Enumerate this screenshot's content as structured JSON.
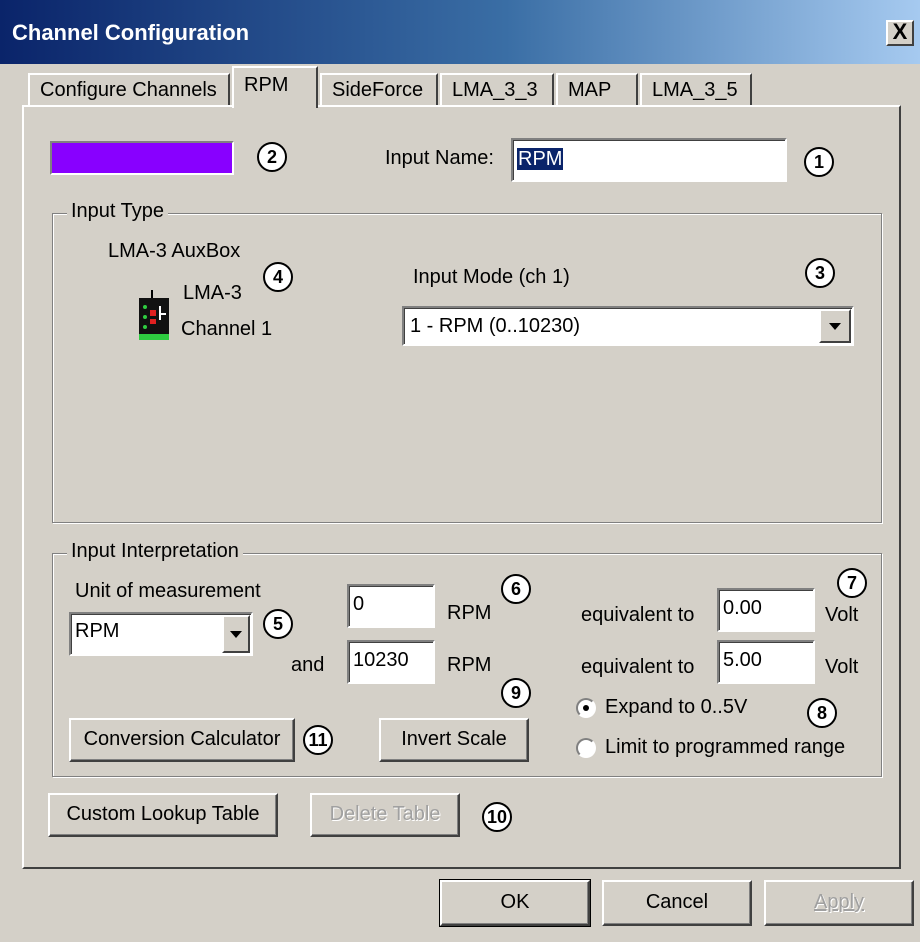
{
  "window": {
    "title": "Channel Configuration",
    "close_label": "X"
  },
  "tabs": [
    {
      "label": "Configure Channels",
      "active": false
    },
    {
      "label": "RPM",
      "active": true
    },
    {
      "label": "SideForce",
      "active": false
    },
    {
      "label": "LMA_3_3",
      "active": false
    },
    {
      "label": "MAP",
      "active": false
    },
    {
      "label": "LMA_3_5",
      "active": false
    }
  ],
  "colors": {
    "channel_color": "#8800ff",
    "title_gradient_start": "#0a246a",
    "dialog_bg": "#d4d0c8"
  },
  "input_name": {
    "label": "Input Name:",
    "value": "RPM"
  },
  "input_type": {
    "legend": "Input Type",
    "device_title": "LMA-3 AuxBox",
    "device_name": "LMA-3",
    "device_channel": "Channel 1",
    "device_icon": "lma3-device-icon",
    "mode_label": "Input Mode (ch 1)",
    "mode_selected": "1 - RPM (0..10230)"
  },
  "interpretation": {
    "legend": "Input Interpretation",
    "unit_label": "Unit of measurement",
    "unit_selected": "RPM",
    "and_label": "and",
    "min_value": "0",
    "max_value": "10230",
    "min_unit": "RPM",
    "max_unit": "RPM",
    "equiv_label_1": "equivalent to",
    "equiv_label_2": "equivalent to",
    "volt_min": "0.00",
    "volt_max": "5.00",
    "volt_unit_1": "Volt",
    "volt_unit_2": "Volt",
    "radio_expand": "Expand to 0..5V",
    "radio_limit": "Limit to programmed range",
    "radio_selected": "expand",
    "conversion_button": "Conversion Calculator",
    "invert_button": "Invert Scale"
  },
  "lookup": {
    "custom_button": "Custom Lookup Table",
    "delete_button": "Delete Table"
  },
  "footer": {
    "ok": "OK",
    "cancel": "Cancel",
    "apply": "Apply"
  },
  "markers": [
    "1",
    "2",
    "3",
    "4",
    "5",
    "6",
    "7",
    "8",
    "9",
    "10",
    "11"
  ]
}
